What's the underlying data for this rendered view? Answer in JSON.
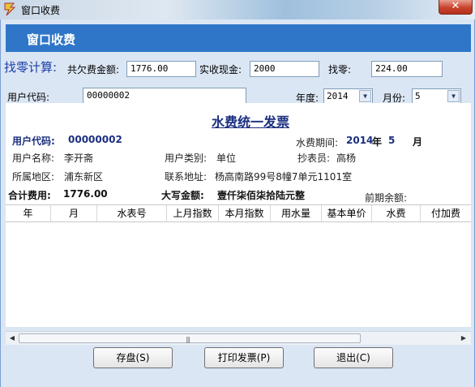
{
  "window": {
    "title": "窗口收费",
    "close_glyph": "✕"
  },
  "header": {
    "title": "窗口收费"
  },
  "calc": {
    "title": "找零计算:",
    "total_due_label": "共欠费金额:",
    "total_due_value": "1776.00",
    "cash_label": "实收现金:",
    "cash_value": "2000",
    "change_label": "找零:",
    "change_value": "224.00"
  },
  "query": {
    "user_code_label": "用户代码:",
    "user_code_value": "00000002",
    "year_label": "年度:",
    "year_value": "2014",
    "month_label": "月份:",
    "month_value": "5"
  },
  "invoice": {
    "title": "水费统一发票",
    "user_code_label": "用户代码:",
    "user_code_value": "00000002",
    "period_label": "水费期间:",
    "period_year": "2014",
    "period_year_unit": "年",
    "period_month": "5",
    "period_month_unit": "月",
    "user_name_label": "用户名称:",
    "user_name_value": "李开斋",
    "user_type_label": "用户类别:",
    "user_type_value": "单位",
    "meter_reader_label": "抄表员:",
    "meter_reader_value": "高杨",
    "region_label": "所属地区:",
    "region_value": "浦东新区",
    "address_label": "联系地址:",
    "address_value": "杨高南路99号8幢7单元1101室",
    "total_label": "合计费用:",
    "total_value": "1776.00",
    "uppercase_label": "大写金额:",
    "uppercase_value": "壹仟柒佰柒拾陆元整",
    "prev_balance_label": "前期余额:",
    "columns": [
      "年",
      "月",
      "水表号",
      "上月指数",
      "本月指数",
      "用水量",
      "基本单价",
      "水费",
      "付加费"
    ]
  },
  "scrollbar": {
    "left_arrow": "◀",
    "right_arrow": "▶",
    "grip": "|||"
  },
  "buttons": {
    "save": "存盘(S)",
    "print": "打印发票(P)",
    "exit": "退出(C)"
  }
}
